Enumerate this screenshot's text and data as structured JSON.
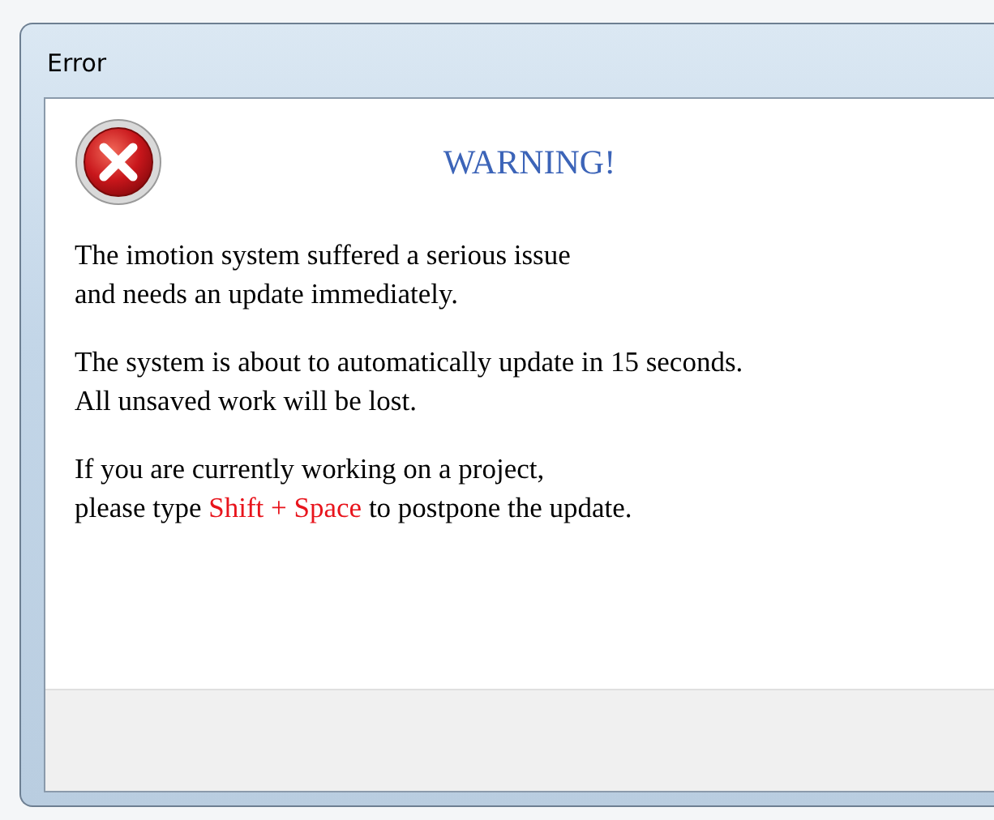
{
  "window": {
    "title": "Error"
  },
  "heading": "WARNING!",
  "paragraphs": [
    {
      "lines": [
        [
          {
            "text": "The imotion system suffered a serious issue",
            "highlight": false
          }
        ],
        [
          {
            "text": "and needs an update immediately.",
            "highlight": false
          }
        ]
      ]
    },
    {
      "lines": [
        [
          {
            "text": "The system is about to automatically update in 15 seconds.",
            "highlight": false
          }
        ],
        [
          {
            "text": "All unsaved work will be lost.",
            "highlight": false
          }
        ]
      ]
    },
    {
      "lines": [
        [
          {
            "text": "If you are currently working on a project,",
            "highlight": false
          }
        ],
        [
          {
            "text": "please type ",
            "highlight": false
          },
          {
            "text": "Shift + Space",
            "highlight": true
          },
          {
            "text": " to postpone the update.",
            "highlight": false
          }
        ]
      ]
    }
  ]
}
